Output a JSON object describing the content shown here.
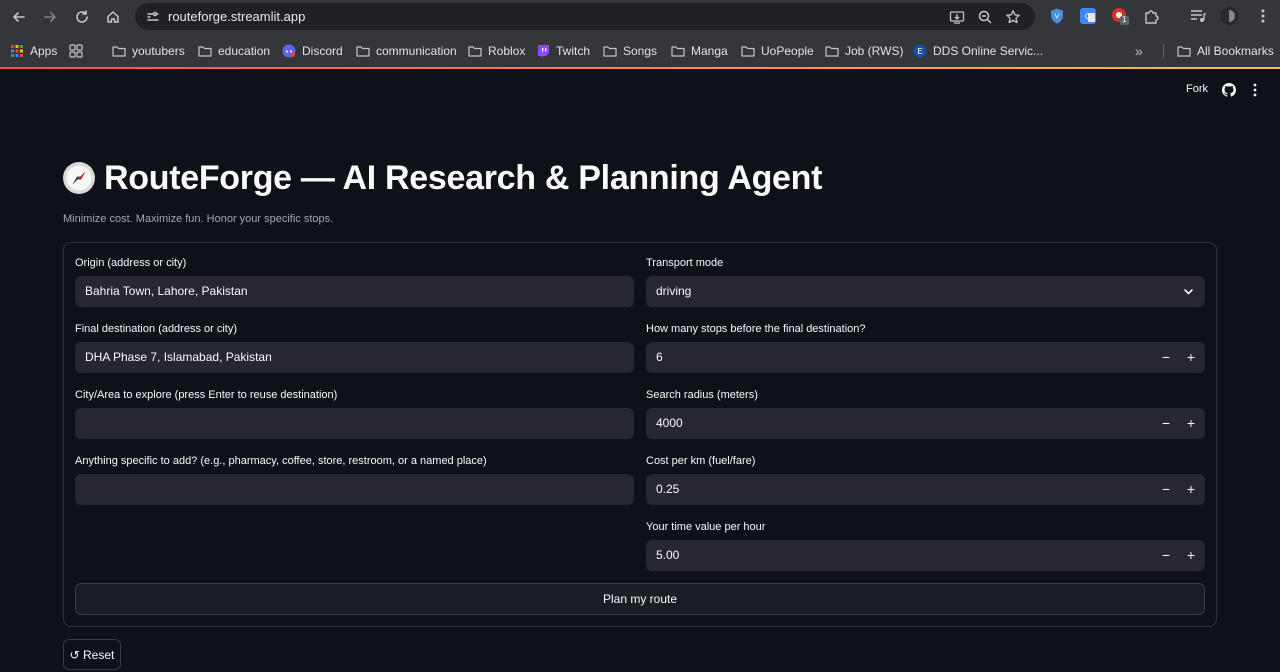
{
  "browser": {
    "url": "routeforge.streamlit.app",
    "bookmarks": [
      "Apps",
      "youtubers",
      "education",
      "Discord",
      "communication",
      "Roblox",
      "Twitch",
      "Songs",
      "Manga",
      "UoPeople",
      "Job (RWS)",
      "DDS Online Servic..."
    ],
    "all_bookmarks": "All Bookmarks",
    "extension_badge": "1"
  },
  "header": {
    "fork": "Fork"
  },
  "app": {
    "title": "RouteForge — AI Research & Planning Agent",
    "subtitle": "Minimize cost. Maximize fun. Honor your specific stops."
  },
  "form": {
    "origin_label": "Origin (address or city)",
    "origin_value": "Bahria Town, Lahore, Pakistan",
    "transport_label": "Transport mode",
    "transport_value": "driving",
    "destination_label": "Final destination (address or city)",
    "destination_value": "DHA Phase 7, Islamabad, Pakistan",
    "stops_label": "How many stops before the final destination?",
    "stops_value": "6",
    "explore_label": "City/Area to explore (press Enter to reuse destination)",
    "explore_value": "",
    "radius_label": "Search radius (meters)",
    "radius_value": "4000",
    "specific_label": "Anything specific to add? (e.g., pharmacy, coffee, store, restroom, or a named place)",
    "specific_value": "",
    "cost_label": "Cost per km (fuel/fare)",
    "cost_value": "0.25",
    "time_label": "Your time value per hour",
    "time_value": "5.00",
    "minus": "−",
    "plus": "+",
    "submit_label": "Plan my route"
  },
  "reset_label": "↺ Reset",
  "colors": {
    "background": "#0e1117",
    "input_bg": "#262730",
    "accent": "#ff4b4b"
  }
}
